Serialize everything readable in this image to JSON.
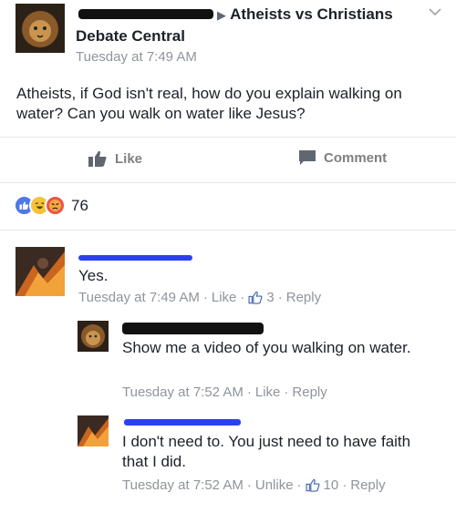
{
  "post": {
    "group": "Atheists vs Christians",
    "group_line2": "Debate Central",
    "timestamp": "Tuesday at 7:49 AM",
    "text": "Atheists, if God isn't real, how do you explain walking on water? Can you walk on water like Jesus?",
    "chevron": "chevron-down-icon"
  },
  "actions": {
    "like": "Like",
    "comment": "Comment"
  },
  "reactions": {
    "count": "76",
    "types": [
      "like",
      "haha",
      "angry"
    ]
  },
  "comments": [
    {
      "text": "Yes.",
      "time": "Tuesday at 7:49 AM",
      "like": "Like",
      "like_count": "3",
      "reply": "Reply"
    },
    {
      "text": "Show me a video of you walking on water.",
      "time": "Tuesday at 7:52 AM",
      "like": "Like",
      "reply": "Reply"
    },
    {
      "text": "I don't need to. You just need to have faith that I did.",
      "time": "Tuesday at 7:52 AM",
      "like": "Unlike",
      "like_count": "10",
      "reply": "Reply"
    }
  ],
  "colors": {
    "accent": "#4267b2",
    "meta": "#90949c",
    "redact_blue": "#2b3ff5"
  }
}
